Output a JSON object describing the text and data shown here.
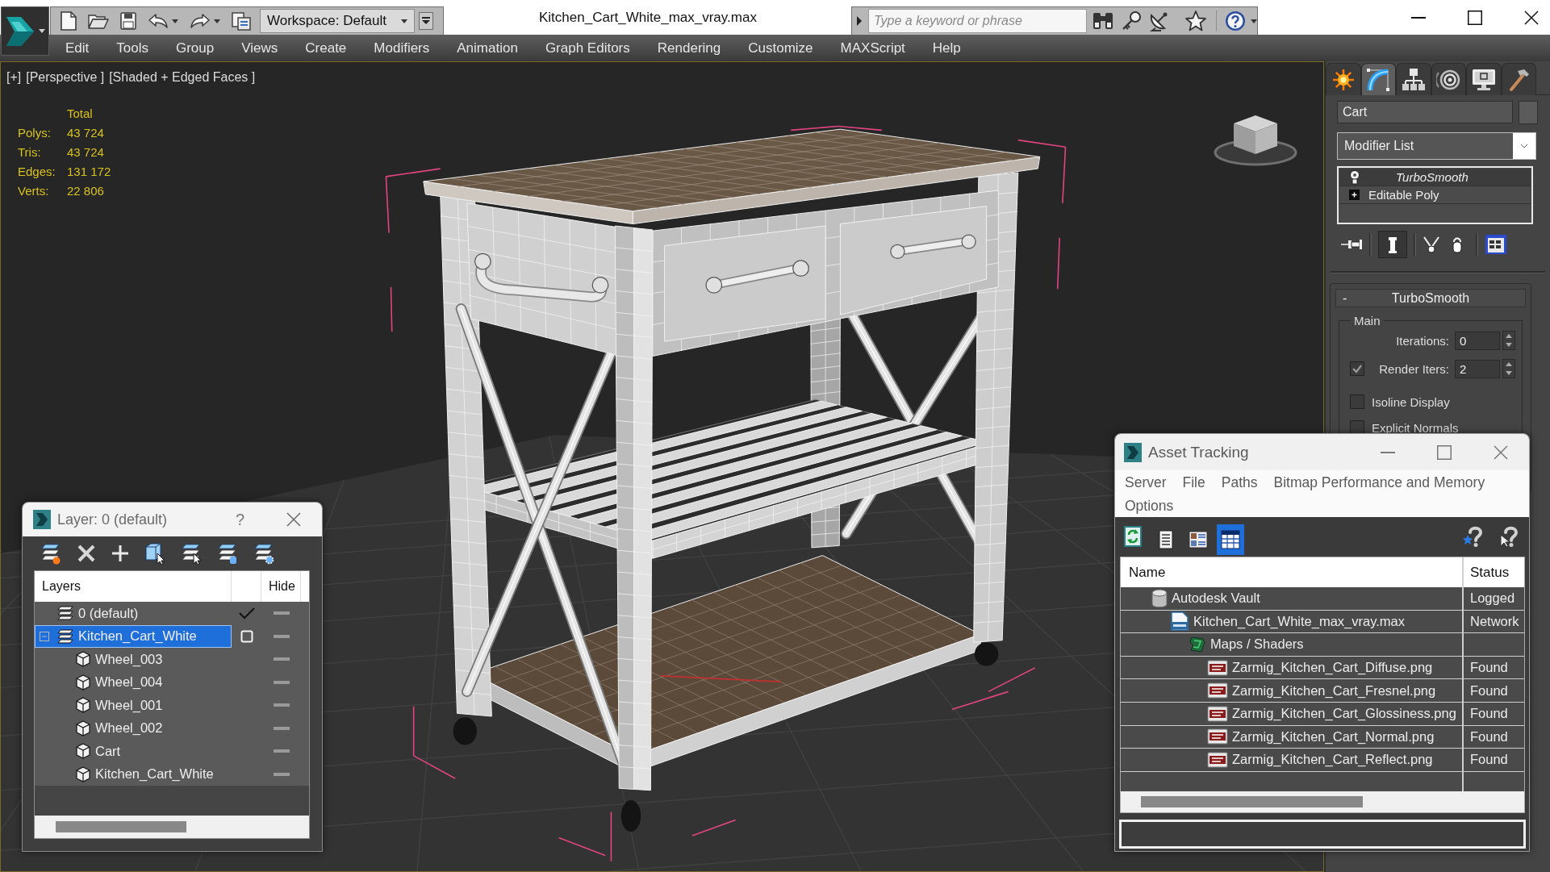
{
  "app": {
    "title": "Kitchen_Cart_White_max_vray.max",
    "workspace": "Workspace: Default",
    "search": {
      "placeholder": "Type a keyword or phrase"
    }
  },
  "menu": [
    "Edit",
    "Tools",
    "Group",
    "Views",
    "Create",
    "Modifiers",
    "Animation",
    "Graph Editors",
    "Rendering",
    "Customize",
    "MAXScript",
    "Help"
  ],
  "viewport": {
    "labels": [
      "[+]",
      "[Perspective ]",
      "[Shaded + Edged Faces ]"
    ],
    "stats": {
      "header": "Total",
      "rows": [
        {
          "label": "Polys:",
          "value": "43 724"
        },
        {
          "label": "Tris:",
          "value": "43 724"
        },
        {
          "label": "Edges:",
          "value": "131 172"
        },
        {
          "label": "Verts:",
          "value": "22 806"
        }
      ]
    }
  },
  "command_panel": {
    "tabs": [
      {
        "kind": "create",
        "selected": false
      },
      {
        "kind": "modify",
        "selected": true
      },
      {
        "kind": "hierarchy",
        "selected": false
      },
      {
        "kind": "motion",
        "selected": false
      },
      {
        "kind": "display",
        "selected": false
      },
      {
        "kind": "utilities",
        "selected": false
      }
    ],
    "object_name": "Cart",
    "modifier_list": "Modifier List",
    "stack": [
      {
        "kind": "modifier",
        "label": "TurboSmooth"
      },
      {
        "kind": "base",
        "label": "Editable Poly"
      }
    ],
    "show_end_result": true,
    "rollout": {
      "collapse": "-",
      "title": "TurboSmooth",
      "group": "Main",
      "iterations": {
        "label": "Iterations:",
        "value": "0"
      },
      "render_iters": {
        "label": "Render Iters:",
        "value": "2",
        "checked": true
      },
      "options": [
        {
          "label": "Isoline Display",
          "checked": false
        },
        {
          "label": "Explicit Normals",
          "checked": false
        }
      ]
    }
  },
  "layer_window": {
    "title": "Layer: 0 (default)",
    "help": "?",
    "columns": [
      "Layers",
      "Hide"
    ],
    "layers": [
      {
        "name": "0 (default)",
        "current": true,
        "selected": false,
        "hidden": false
      },
      {
        "name": "Kitchen_Cart_White",
        "current": false,
        "selected": true,
        "hidden": false,
        "expanded": true,
        "children": [
          {
            "name": "Wheel_003",
            "selected": false,
            "hidden": false
          },
          {
            "name": "Wheel_004",
            "selected": false,
            "hidden": false
          },
          {
            "name": "Wheel_001",
            "selected": false,
            "hidden": false
          },
          {
            "name": "Wheel_002",
            "selected": false,
            "hidden": false
          },
          {
            "name": "Cart",
            "selected": false,
            "hidden": false
          },
          {
            "name": "Kitchen_Cart_White",
            "selected": false,
            "hidden": false
          }
        ]
      }
    ]
  },
  "asset_window": {
    "title": "Asset Tracking",
    "menu": [
      "Server",
      "File",
      "Paths",
      "Bitmap Performance and Memory",
      "Options"
    ],
    "view_modes": [
      {
        "kind": "list",
        "selected": false
      },
      {
        "kind": "thumbnails",
        "selected": false
      },
      {
        "kind": "table",
        "selected": true
      }
    ],
    "columns": [
      "Name",
      "Status"
    ],
    "assets": [
      {
        "kind": "vault",
        "name": "Autodesk Vault",
        "status": "Logged",
        "children": [
          {
            "kind": "max_file",
            "name": "Kitchen_Cart_White_max_vray.max",
            "status": "Network",
            "children": [
              {
                "kind": "folder",
                "name": "Maps / Shaders",
                "children": [
                  {
                    "kind": "png",
                    "name": "Zarmig_Kitchen_Cart_Diffuse.png",
                    "status": "Found"
                  },
                  {
                    "kind": "png",
                    "name": "Zarmig_Kitchen_Cart_Fresnel.png",
                    "status": "Found"
                  },
                  {
                    "kind": "png",
                    "name": "Zarmig_Kitchen_Cart_Glossiness.png",
                    "status": "Found"
                  },
                  {
                    "kind": "png",
                    "name": "Zarmig_Kitchen_Cart_Normal.png",
                    "status": "Found"
                  },
                  {
                    "kind": "png",
                    "name": "Zarmig_Kitchen_Cart_Reflect.png",
                    "status": "Found"
                  }
                ]
              }
            ]
          }
        ]
      }
    ]
  }
}
